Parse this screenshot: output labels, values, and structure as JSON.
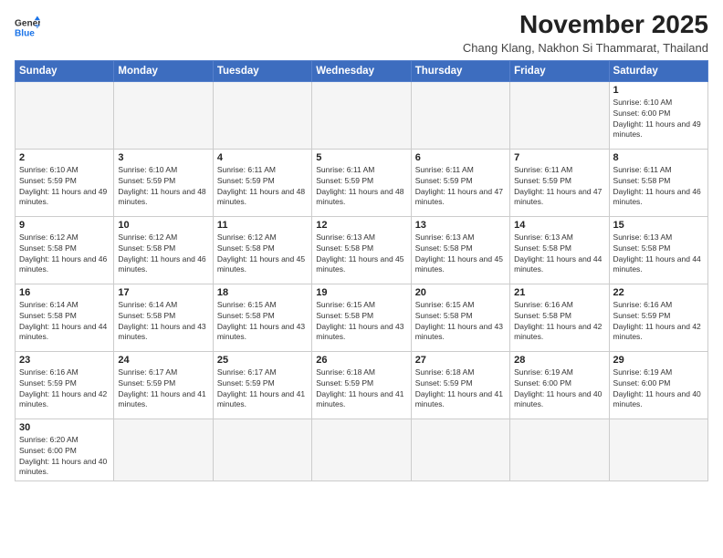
{
  "logo": {
    "text_general": "General",
    "text_blue": "Blue"
  },
  "title": "November 2025",
  "subtitle": "Chang Klang, Nakhon Si Thammarat, Thailand",
  "weekdays": [
    "Sunday",
    "Monday",
    "Tuesday",
    "Wednesday",
    "Thursday",
    "Friday",
    "Saturday"
  ],
  "weeks": [
    [
      {
        "day": null
      },
      {
        "day": null
      },
      {
        "day": null
      },
      {
        "day": null
      },
      {
        "day": null
      },
      {
        "day": null
      },
      {
        "day": "1",
        "sunrise": "6:10 AM",
        "sunset": "6:00 PM",
        "daylight": "11 hours and 49 minutes."
      }
    ],
    [
      {
        "day": "2",
        "sunrise": "6:10 AM",
        "sunset": "5:59 PM",
        "daylight": "11 hours and 49 minutes."
      },
      {
        "day": "3",
        "sunrise": "6:10 AM",
        "sunset": "5:59 PM",
        "daylight": "11 hours and 48 minutes."
      },
      {
        "day": "4",
        "sunrise": "6:11 AM",
        "sunset": "5:59 PM",
        "daylight": "11 hours and 48 minutes."
      },
      {
        "day": "5",
        "sunrise": "6:11 AM",
        "sunset": "5:59 PM",
        "daylight": "11 hours and 48 minutes."
      },
      {
        "day": "6",
        "sunrise": "6:11 AM",
        "sunset": "5:59 PM",
        "daylight": "11 hours and 47 minutes."
      },
      {
        "day": "7",
        "sunrise": "6:11 AM",
        "sunset": "5:59 PM",
        "daylight": "11 hours and 47 minutes."
      },
      {
        "day": "8",
        "sunrise": "6:11 AM",
        "sunset": "5:58 PM",
        "daylight": "11 hours and 46 minutes."
      }
    ],
    [
      {
        "day": "9",
        "sunrise": "6:12 AM",
        "sunset": "5:58 PM",
        "daylight": "11 hours and 46 minutes."
      },
      {
        "day": "10",
        "sunrise": "6:12 AM",
        "sunset": "5:58 PM",
        "daylight": "11 hours and 46 minutes."
      },
      {
        "day": "11",
        "sunrise": "6:12 AM",
        "sunset": "5:58 PM",
        "daylight": "11 hours and 45 minutes."
      },
      {
        "day": "12",
        "sunrise": "6:13 AM",
        "sunset": "5:58 PM",
        "daylight": "11 hours and 45 minutes."
      },
      {
        "day": "13",
        "sunrise": "6:13 AM",
        "sunset": "5:58 PM",
        "daylight": "11 hours and 45 minutes."
      },
      {
        "day": "14",
        "sunrise": "6:13 AM",
        "sunset": "5:58 PM",
        "daylight": "11 hours and 44 minutes."
      },
      {
        "day": "15",
        "sunrise": "6:13 AM",
        "sunset": "5:58 PM",
        "daylight": "11 hours and 44 minutes."
      }
    ],
    [
      {
        "day": "16",
        "sunrise": "6:14 AM",
        "sunset": "5:58 PM",
        "daylight": "11 hours and 44 minutes."
      },
      {
        "day": "17",
        "sunrise": "6:14 AM",
        "sunset": "5:58 PM",
        "daylight": "11 hours and 43 minutes."
      },
      {
        "day": "18",
        "sunrise": "6:15 AM",
        "sunset": "5:58 PM",
        "daylight": "11 hours and 43 minutes."
      },
      {
        "day": "19",
        "sunrise": "6:15 AM",
        "sunset": "5:58 PM",
        "daylight": "11 hours and 43 minutes."
      },
      {
        "day": "20",
        "sunrise": "6:15 AM",
        "sunset": "5:58 PM",
        "daylight": "11 hours and 43 minutes."
      },
      {
        "day": "21",
        "sunrise": "6:16 AM",
        "sunset": "5:58 PM",
        "daylight": "11 hours and 42 minutes."
      },
      {
        "day": "22",
        "sunrise": "6:16 AM",
        "sunset": "5:59 PM",
        "daylight": "11 hours and 42 minutes."
      }
    ],
    [
      {
        "day": "23",
        "sunrise": "6:16 AM",
        "sunset": "5:59 PM",
        "daylight": "11 hours and 42 minutes."
      },
      {
        "day": "24",
        "sunrise": "6:17 AM",
        "sunset": "5:59 PM",
        "daylight": "11 hours and 41 minutes."
      },
      {
        "day": "25",
        "sunrise": "6:17 AM",
        "sunset": "5:59 PM",
        "daylight": "11 hours and 41 minutes."
      },
      {
        "day": "26",
        "sunrise": "6:18 AM",
        "sunset": "5:59 PM",
        "daylight": "11 hours and 41 minutes."
      },
      {
        "day": "27",
        "sunrise": "6:18 AM",
        "sunset": "5:59 PM",
        "daylight": "11 hours and 41 minutes."
      },
      {
        "day": "28",
        "sunrise": "6:19 AM",
        "sunset": "6:00 PM",
        "daylight": "11 hours and 40 minutes."
      },
      {
        "day": "29",
        "sunrise": "6:19 AM",
        "sunset": "6:00 PM",
        "daylight": "11 hours and 40 minutes."
      }
    ],
    [
      {
        "day": "30",
        "sunrise": "6:20 AM",
        "sunset": "6:00 PM",
        "daylight": "11 hours and 40 minutes."
      },
      {
        "day": null
      },
      {
        "day": null
      },
      {
        "day": null
      },
      {
        "day": null
      },
      {
        "day": null
      },
      {
        "day": null
      }
    ]
  ]
}
